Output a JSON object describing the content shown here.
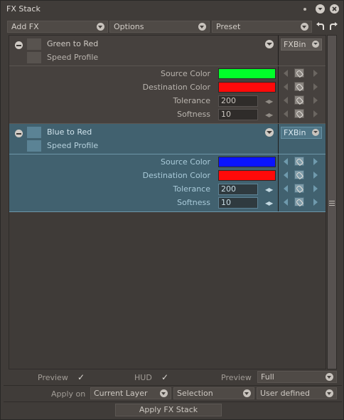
{
  "window": {
    "title": "FX Stack"
  },
  "toolbar": {
    "add_fx": "Add FX",
    "options": "Options",
    "preset": "Preset"
  },
  "fx_items": [
    {
      "name": "Green to Red",
      "speed_profile": "Speed Profile",
      "bin_label": "FXBin",
      "params": {
        "source_color_label": "Source Color",
        "source_color": "#00ff2a",
        "dest_color_label": "Destination Color",
        "dest_color": "#ff0a0a",
        "tolerance_label": "Tolerance",
        "tolerance": "200",
        "softness_label": "Softness",
        "softness": "10"
      }
    },
    {
      "name": "Blue to Red",
      "speed_profile": "Speed Profile",
      "bin_label": "FXBin",
      "params": {
        "source_color_label": "Source Color",
        "source_color": "#0a14ff",
        "dest_color_label": "Destination Color",
        "dest_color": "#ff0a0a",
        "tolerance_label": "Tolerance",
        "tolerance": "200",
        "softness_label": "Softness",
        "softness": "10"
      }
    }
  ],
  "bottom": {
    "preview_label": "Preview",
    "preview_checked": "✓",
    "hud_label": "HUD",
    "hud_checked": "✓",
    "preview_mode_label": "Preview",
    "preview_mode_value": "Full",
    "apply_on_label": "Apply on",
    "apply_on_value": "Current Layer",
    "selection_value": "Selection",
    "range_value": "User defined",
    "apply_button": "Apply FX Stack"
  }
}
